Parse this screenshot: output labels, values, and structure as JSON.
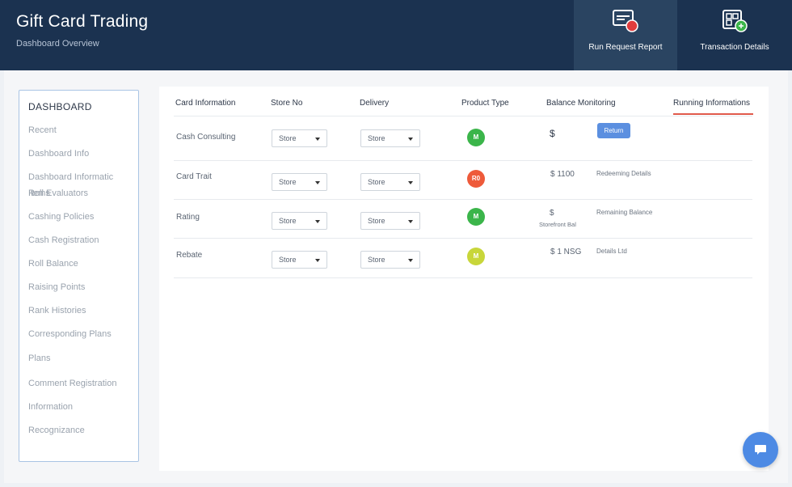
{
  "header": {
    "title": "Gift Card Trading",
    "subtitle": "Dashboard Overview",
    "buttons": [
      {
        "label": "Run Request Report",
        "icon": "card-alert-icon"
      },
      {
        "label": "Transaction Details",
        "icon": "qr-code-icon"
      }
    ]
  },
  "sidebar": {
    "title": "DASHBOARD",
    "items": [
      "Recent",
      "Dashboard Info",
      "Dashboard Informatic Items",
      "Roll Evaluators",
      "Cashing Policies",
      "Cash Registration",
      "Roll Balance",
      "Raising Points",
      "Rank Histories",
      "Corresponding Plans",
      "Plans",
      "Comment Registration",
      "Information",
      "Recognizance"
    ]
  },
  "table": {
    "headers": [
      "Card Information",
      "Store No",
      "Delivery",
      "Product Type",
      "Balance Monitoring",
      "Running Informations"
    ],
    "rows": [
      {
        "name": "Cash Consulting",
        "select1": "Store",
        "select2": "Store",
        "status": {
          "text": "M",
          "color": "#3bb54a"
        },
        "balance": "$",
        "balance_sub": "",
        "info": "Return",
        "info_is_button": true
      },
      {
        "name": "Card Trait",
        "select1": "Store",
        "select2": "Store",
        "status": {
          "text": "R0",
          "color": "#ee5a3a"
        },
        "balance": "$ 1100",
        "balance_sub": "",
        "info": "Redeeming Details",
        "info_is_button": false
      },
      {
        "name": "Rating",
        "select1": "Store",
        "select2": "Store",
        "status": {
          "text": "M",
          "color": "#3bb54a"
        },
        "balance": "$",
        "balance_sub": "Storefront Bal",
        "info": "Remaining Balance",
        "info_is_button": false
      },
      {
        "name": "Rebate",
        "select1": "Store",
        "select2": "Store",
        "status": {
          "text": "M",
          "color": "#c8d63a"
        },
        "balance": "$ 1 NSG",
        "balance_sub": "",
        "info": "Details Ltd",
        "info_is_button": false
      }
    ]
  },
  "fab": {
    "icon": "chat-icon"
  },
  "colors": {
    "header_bg": "#1b3250",
    "accent_blue": "#5b8fe0",
    "tab_underline": "#e05a4b"
  }
}
